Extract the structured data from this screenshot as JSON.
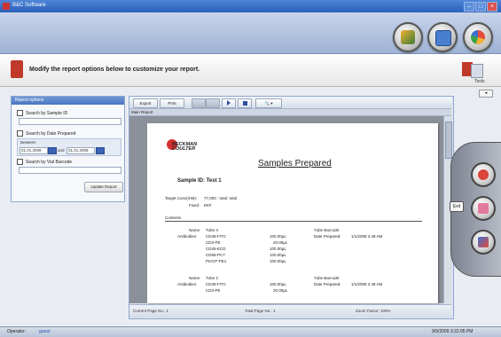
{
  "window": {
    "title": "B&C Software"
  },
  "instruction": "Modify the report options below to customize your report.",
  "tools_label": "Tools",
  "left_panel": {
    "header": "Report options",
    "option1": "Search by Sample ID",
    "option2": "Search by Date Prepared",
    "between_label": "Between",
    "date_from": "01.01.2008",
    "and_label": "and",
    "date_to": "01.01.2008",
    "option3": "Search by Vial Barcode",
    "update_button": "Update Report"
  },
  "toolbar": {
    "export_label": "Export",
    "print_label": "Print"
  },
  "main_tab": "Main Report",
  "report": {
    "logo_line1": "BECKMAN",
    "logo_line2": "COULTER",
    "title": "Samples Prepared",
    "sample_id": "Sample ID: Test 1",
    "target_conc_label": "Target Conc(mM):",
    "target_conc_value": "77,000 : total: total",
    "fixed_label": "Fixed:",
    "fixed_value": "EKF",
    "contents_header": "Contents",
    "block1": {
      "name_label": "Name:",
      "name_value": "Tube 4",
      "tube_barcode_label": "Tube Barcode:",
      "antibodies_label": "Antibodies:",
      "antibodies": [
        "CD45-FITC",
        "CD3-PE",
        "CD45-ECD",
        "CD56-PC7",
        "PerCP-PE1"
      ],
      "amounts": [
        "100.00µL",
        "20.00µL",
        "100.00µL",
        "100.00µL",
        "100.00µL"
      ],
      "date_prepared_label": "Date Prepared:",
      "date_prepared_value": "1/1/2008 2:48 AM"
    },
    "block2": {
      "name_label": "Name:",
      "name_value": "Tube 2",
      "tube_barcode_label": "Tube Barcode:",
      "antibodies_label": "Antibodies:",
      "antibodies": [
        "CD45-FITC",
        "CD3-PE"
      ],
      "amounts": [
        "100.00µL",
        "20.00µL"
      ],
      "date_prepared_label": "Date Prepared:",
      "date_prepared_value": "1/1/2008 2:48 AM"
    }
  },
  "report_status": {
    "current_page": "Current Page No.: 1",
    "total_pages": "Total Page No.: 1",
    "zoom": "Zoom Factor: 100%"
  },
  "dock": {
    "exit_label": "Exit"
  },
  "restore_label": "◂",
  "status": {
    "operator_label": "Operator:",
    "operator_value": "guest",
    "datetime": "9/9/2009 3:22:05 PM"
  }
}
